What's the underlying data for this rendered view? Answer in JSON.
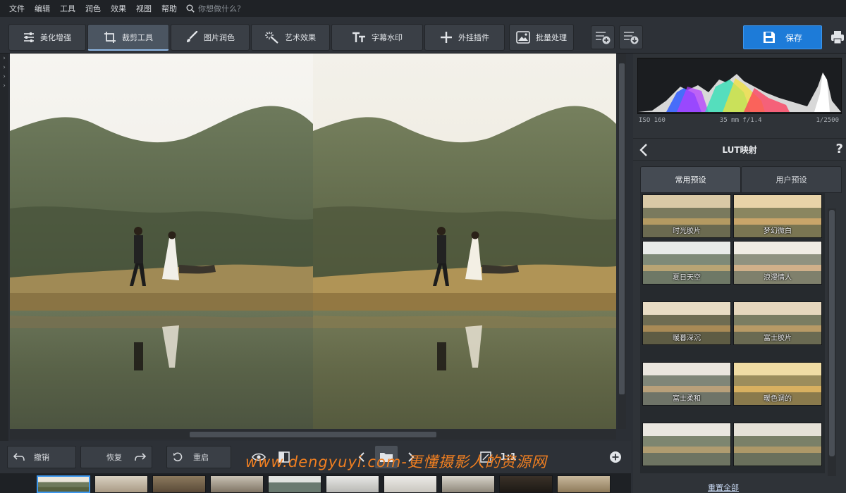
{
  "menu": {
    "items": [
      "文件",
      "编辑",
      "工具",
      "润色",
      "效果",
      "视图",
      "帮助"
    ],
    "search_placeholder": "你想做什么？"
  },
  "toolbar": {
    "tabs": [
      {
        "label": "美化增强",
        "icon": "sliders-icon"
      },
      {
        "label": "裁剪工具",
        "icon": "crop-icon"
      },
      {
        "label": "图片润色",
        "icon": "brush-icon"
      },
      {
        "label": "艺术效果",
        "icon": "magic-wand-icon"
      },
      {
        "label": "字幕水印",
        "icon": "text-icon"
      },
      {
        "label": "外挂插件",
        "icon": "plus-icon"
      },
      {
        "label": "批量处理",
        "icon": "images-icon"
      }
    ],
    "active_tab": "裁剪工具",
    "save_label": "保存"
  },
  "bottombar": {
    "undo_label": "撤销",
    "redo_label": "恢复",
    "revert_label": "重启",
    "zoom_label": "1:1"
  },
  "watermark": "www.dengyuyi.com-更懂摄影人的资源网",
  "panel": {
    "exif": {
      "iso": "ISO 160",
      "lens": "35 mm f/1.4",
      "shutter": "1/2500"
    },
    "title": "LUT映射",
    "help": "?",
    "tabs": [
      "常用预设",
      "用户预设"
    ],
    "presets": [
      "时光胶片",
      "梦幻微白",
      "夏日天空",
      "浪漫情人",
      "暖暮深沉",
      "富士胶片",
      "富士柔和",
      "暖色调的",
      "",
      ""
    ],
    "reset_label": "重置全部"
  },
  "colors": {
    "accent": "#1d7bd8",
    "watermark": "#f07f21",
    "panel_bg": "#2f3338"
  }
}
